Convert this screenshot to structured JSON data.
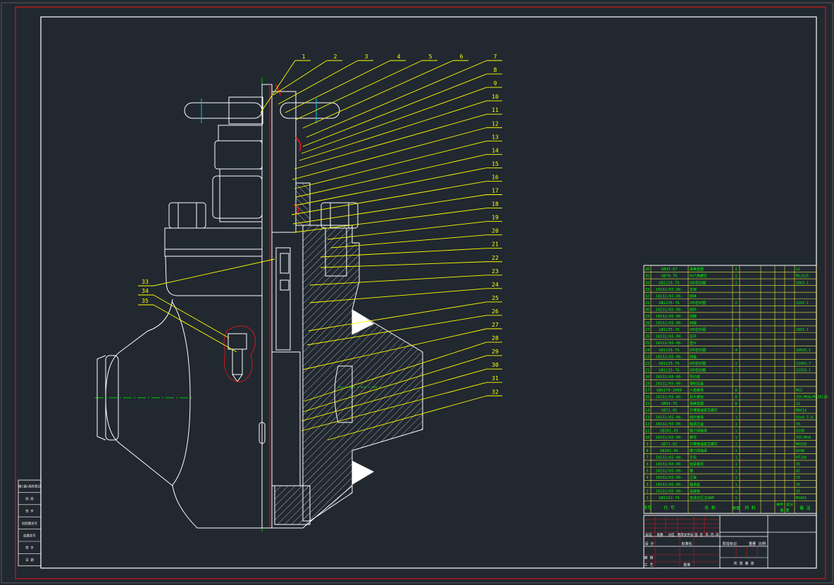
{
  "colors": {
    "background": "#212830",
    "frame": "#ffffff",
    "border_red": "#d01818",
    "leader": "#ffff00",
    "table_text": "#00ff00",
    "centerline": "#00cc00",
    "cyan": "#00c8e0"
  },
  "callouts_right": [
    "1",
    "2",
    "3",
    "4",
    "5",
    "6",
    "7",
    "8",
    "9",
    "10",
    "11",
    "12",
    "13",
    "14",
    "15",
    "16",
    "17",
    "18",
    "19",
    "20",
    "21",
    "22",
    "23",
    "24",
    "25",
    "26",
    "27",
    "28",
    "29",
    "30",
    "31",
    "32"
  ],
  "callouts_left": [
    "33",
    "34",
    "35"
  ],
  "parts_table": {
    "rows": [
      {
        "no": "36",
        "code": "GB93-87",
        "name": "弹簧垫圈",
        "qty": "2",
        "mat": "",
        "note": "12"
      },
      {
        "no": "35",
        "code": "GB70-76",
        "name": "内六角螺钉",
        "qty": "2",
        "mat": "",
        "note": "M12X25"
      },
      {
        "no": "34",
        "code": "GB1235-76",
        "name": "O形密封圈",
        "qty": "1",
        "mat": "",
        "note": "20X3.1"
      },
      {
        "no": "33",
        "code": "JA532/65-00-",
        "name": "支架",
        "qty": "",
        "mat": "",
        "note": ""
      },
      {
        "no": "32",
        "code": "JA532/65-00-",
        "name": "阀体",
        "qty": "",
        "mat": "",
        "note": ""
      },
      {
        "no": "31",
        "code": "GB1235-76",
        "name": "O形密封圈",
        "qty": "2",
        "mat": "",
        "note": "22X3.1"
      },
      {
        "no": "30",
        "code": "JA532/65-00-",
        "name": "阀杆",
        "qty": "",
        "mat": "",
        "note": ""
      },
      {
        "no": "29",
        "code": "JA532/65-00-",
        "name": "阀瓣",
        "qty": "",
        "mat": "",
        "note": ""
      },
      {
        "no": "28",
        "code": "JA532/65-00-",
        "name": "阀座",
        "qty": "",
        "mat": "",
        "note": ""
      },
      {
        "no": "27",
        "code": "GB1235-76",
        "name": "O形密封圈",
        "qty": "3",
        "mat": "",
        "note": "28X3.1"
      },
      {
        "no": "26",
        "code": "JA532/65-00-",
        "name": "压环",
        "qty": "",
        "mat": "",
        "note": ""
      },
      {
        "no": "25",
        "code": "JA532/65-00-",
        "name": "垫片",
        "qty": "",
        "mat": "",
        "note": ""
      },
      {
        "no": "24",
        "code": "GB1235-76",
        "name": "O形密封圈",
        "qty": "4",
        "mat": "",
        "note": "105X3.1"
      },
      {
        "no": "23",
        "code": "JA532/65-00-",
        "name": "阀盖",
        "qty": "",
        "mat": "",
        "note": ""
      },
      {
        "no": "22",
        "code": "GB1235-76",
        "name": "O形密封圈",
        "qty": "1",
        "mat": "",
        "note": "110X3.7"
      },
      {
        "no": "21",
        "code": "GB1235-76",
        "name": "O形密封圈",
        "qty": "1",
        "mat": "",
        "note": "115X3.1"
      },
      {
        "no": "20",
        "code": "JA532/65-00-",
        "name": "导向套",
        "qty": "",
        "mat": "",
        "note": ""
      },
      {
        "no": "19",
        "code": "JA532/65-00-",
        "name": "填料压盖",
        "qty": "",
        "mat": "",
        "note": ""
      },
      {
        "no": "17",
        "code": "GB6170-2000",
        "name": "六角螺母",
        "qty": "8",
        "mat": "",
        "note": "M22"
      },
      {
        "no": "16",
        "code": "JA532/65-00-",
        "name": "双头螺柱",
        "qty": "8",
        "mat": "",
        "note": "35CrMoA/M22X110"
      },
      {
        "no": "15",
        "code": "GB93-76",
        "name": "弹簧垫圈",
        "qty": "8",
        "mat": "",
        "note": "22"
      },
      {
        "no": "14",
        "code": "GB71-85",
        "name": "开槽锥端紧定螺钉",
        "qty": "1",
        "mat": "",
        "note": "M8X14"
      },
      {
        "no": "13",
        "code": "JA532/65-00-",
        "name": "阀杆螺母",
        "qty": "1",
        "mat": "",
        "note": "QSn6.5-0.1"
      },
      {
        "no": "12",
        "code": "JA532/65-00-",
        "name": "轴承压盖",
        "qty": "1",
        "mat": "",
        "note": "35"
      },
      {
        "no": "11",
        "code": "GB301-85",
        "name": "推力球轴承",
        "qty": "1",
        "mat": "",
        "note": "8108"
      },
      {
        "no": "10",
        "code": "JA532/65-00-",
        "name": "螺母",
        "qty": "1",
        "mat": "",
        "note": "35CrMoA"
      },
      {
        "no": "9",
        "code": "GB71-85",
        "name": "开槽锥端紧定螺钉",
        "qty": "1",
        "mat": "",
        "note": "M6X10"
      },
      {
        "no": "8",
        "code": "GB301-85",
        "name": "推力球轴承",
        "qty": "1",
        "mat": "",
        "note": "8108"
      },
      {
        "no": "7",
        "code": "JA532/65-00-",
        "name": "手轮",
        "qty": "1",
        "mat": "",
        "note": "HT200"
      },
      {
        "no": "6",
        "code": "JA532/65-00-",
        "name": "锁紧螺母",
        "qty": "1",
        "mat": "",
        "note": "35"
      },
      {
        "no": "5",
        "code": "JA532/65-00-",
        "name": "键",
        "qty": "1",
        "mat": "",
        "note": "45"
      },
      {
        "no": "4",
        "code": "JA532/65-00-",
        "name": "压板",
        "qty": "1",
        "mat": "",
        "note": "25"
      },
      {
        "no": "3",
        "code": "JA532/65-00-",
        "name": "轴承座",
        "qty": "1",
        "mat": "",
        "note": "35"
      },
      {
        "no": "2",
        "code": "JA532/65-00-",
        "name": "连接板",
        "qty": "1",
        "mat": "",
        "note": "35"
      },
      {
        "no": "1",
        "code": "GB1152-79",
        "name": "直通式压注油杯",
        "qty": "1",
        "mat": "",
        "note": "M10X1"
      }
    ],
    "header": {
      "no": "序号",
      "code": "代 号",
      "name": "名 称",
      "qty": "数量",
      "mat": "材 料",
      "single": "单件",
      "total": "总计",
      "weight": "重 量",
      "note": "备 注"
    }
  },
  "title_block": {
    "labels_row1": [
      "标记",
      "处数",
      "分区",
      "更改文件号",
      "签 名",
      "年.月.日"
    ],
    "labels_row2": [
      "设 计",
      "",
      "标准化"
    ],
    "stage_labels": [
      "阶段标记",
      "重量",
      "比例"
    ],
    "left_labels": [
      "审 核",
      "工 艺",
      "批准"
    ],
    "sheet_label": "共  张  第  张"
  },
  "side_strip": {
    "labels": [
      "借(通)用件登记",
      "旧 底",
      "签 字",
      "旧底图总号",
      "底图总号",
      "签 字",
      "日 期"
    ]
  }
}
